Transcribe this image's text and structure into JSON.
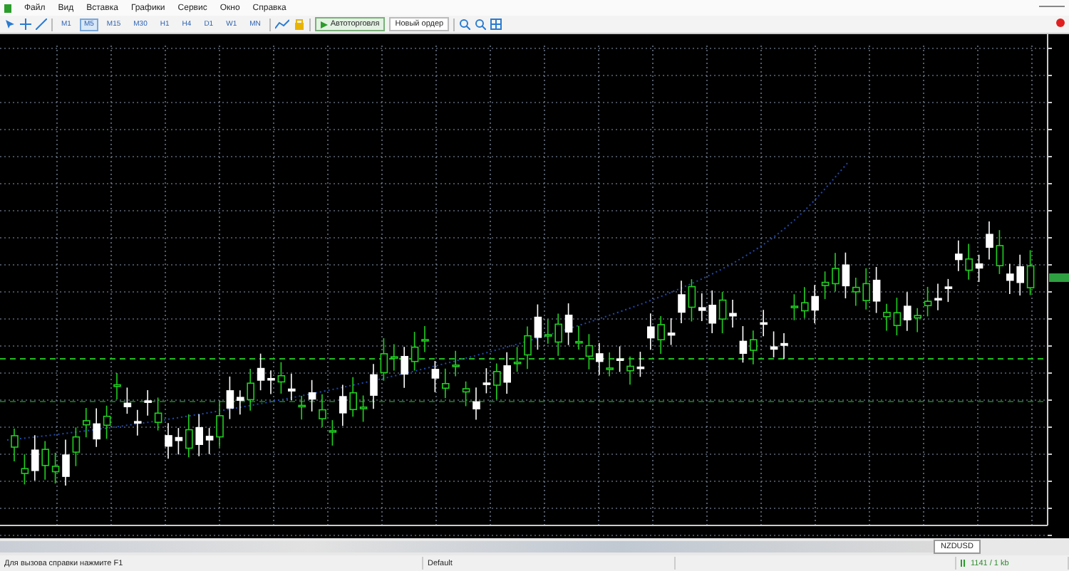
{
  "menu": [
    "Файл",
    "Вид",
    "Вставка",
    "Графики",
    "Сервис",
    "Окно",
    "Справка"
  ],
  "toolbar": {
    "timeframes": [
      {
        "label": "M1",
        "selected": false
      },
      {
        "label": "M5",
        "selected": true
      },
      {
        "label": "M15",
        "selected": false
      },
      {
        "label": "M30",
        "selected": false
      },
      {
        "label": "H1",
        "selected": false
      },
      {
        "label": "H4",
        "selected": false
      },
      {
        "label": "D1",
        "selected": false
      },
      {
        "label": "W1",
        "selected": false
      },
      {
        "label": "MN",
        "selected": false
      }
    ],
    "autotrading": {
      "label": "Автоторговля",
      "on": true
    },
    "new_order": "Новый ордер"
  },
  "chart_tabs": [
    {
      "label": "NZDUSD",
      "selected": true
    }
  ],
  "status_bar": {
    "help": "Для вызова справки нажмите F1",
    "profile": "Default",
    "traffic": "1141 / 1 kb"
  }
}
